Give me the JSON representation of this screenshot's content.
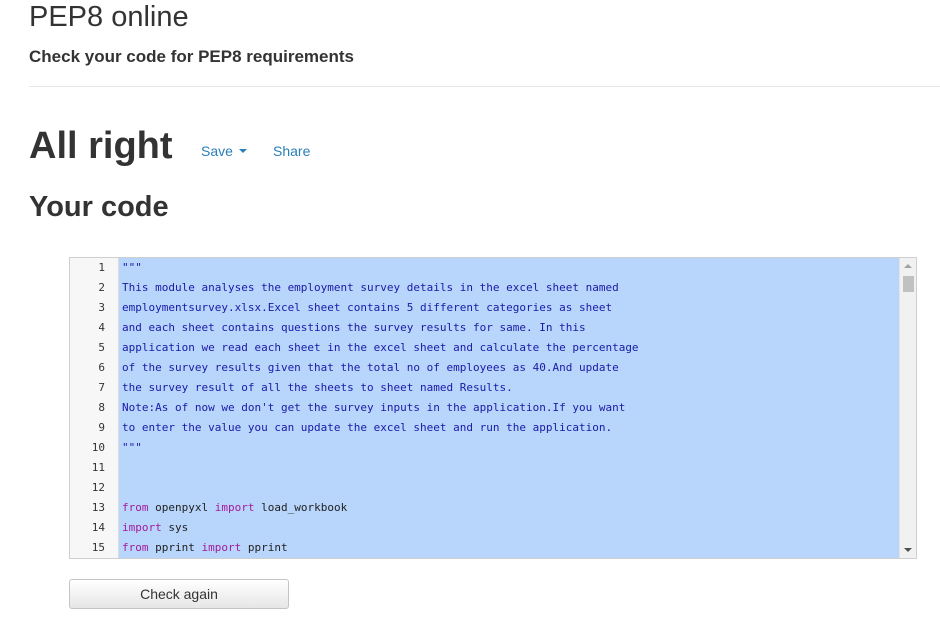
{
  "header": {
    "title": "PEP8 online",
    "subtitle": "Check your code for PEP8 requirements"
  },
  "result": {
    "heading": "All right",
    "save_label": "Save",
    "share_label": "Share"
  },
  "code_section": {
    "heading": "Your code"
  },
  "editor": {
    "lines": [
      {
        "n": "1",
        "kind": "string",
        "text": "\"\"\""
      },
      {
        "n": "2",
        "kind": "string",
        "text": "This module analyses the employment survey details in the excel sheet named"
      },
      {
        "n": "3",
        "kind": "string",
        "text": "employmentsurvey.xlsx.Excel sheet contains 5 different categories as sheet"
      },
      {
        "n": "4",
        "kind": "string",
        "text": "and each sheet contains questions the survey results for same. In this"
      },
      {
        "n": "5",
        "kind": "string",
        "text": "application we read each sheet in the excel sheet and calculate the percentage"
      },
      {
        "n": "6",
        "kind": "string",
        "text": "of the survey results given that the total no of employees as 40.And update"
      },
      {
        "n": "7",
        "kind": "string",
        "text": "the survey result of all the sheets to sheet named Results."
      },
      {
        "n": "8",
        "kind": "string",
        "text": "Note:As of now we don't get the survey inputs in the application.If you want"
      },
      {
        "n": "9",
        "kind": "string",
        "text": "to enter the value you can update the excel sheet and run the application."
      },
      {
        "n": "10",
        "kind": "string",
        "text": "\"\"\""
      },
      {
        "n": "11",
        "kind": "blank",
        "text": ""
      },
      {
        "n": "12",
        "kind": "blank",
        "text": ""
      },
      {
        "n": "13",
        "kind": "code",
        "tokens": [
          {
            "t": "from",
            "kw": true
          },
          {
            "t": " openpyxl ",
            "kw": false
          },
          {
            "t": "import",
            "kw": true
          },
          {
            "t": " load_workbook",
            "kw": false
          }
        ]
      },
      {
        "n": "14",
        "kind": "code",
        "tokens": [
          {
            "t": "import",
            "kw": true
          },
          {
            "t": " sys",
            "kw": false
          }
        ]
      },
      {
        "n": "15",
        "kind": "code",
        "tokens": [
          {
            "t": "from",
            "kw": true
          },
          {
            "t": " pprint ",
            "kw": false
          },
          {
            "t": "import",
            "kw": true
          },
          {
            "t": " pprint",
            "kw": false
          }
        ]
      }
    ]
  },
  "actions": {
    "check_again_label": "Check again"
  },
  "colors": {
    "link": "#2a7fb8",
    "selection": "#b8d5fb",
    "docstring": "#1a1aa6",
    "keyword": "#a41a9e"
  }
}
